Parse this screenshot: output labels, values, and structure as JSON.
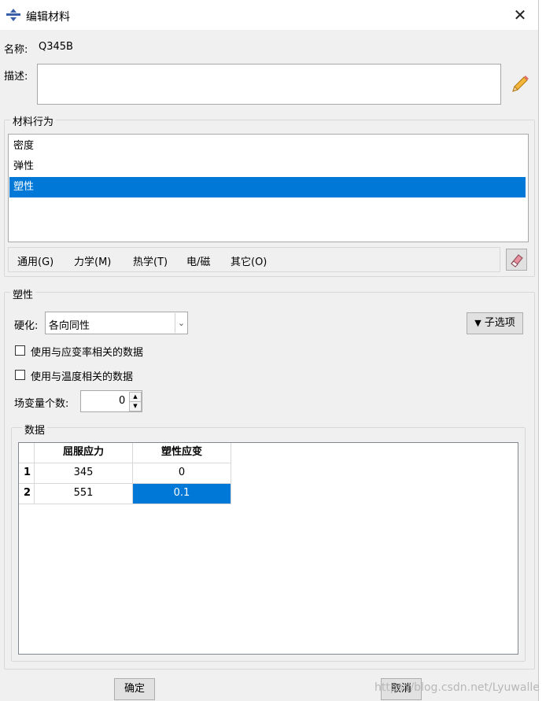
{
  "window": {
    "title": "编辑材料",
    "close": "✕"
  },
  "name_field": {
    "label": "名称:",
    "value": "Q345B"
  },
  "description": {
    "label": "描述:",
    "value": ""
  },
  "behavior_group": {
    "title": "材料行为",
    "items": [
      "密度",
      "弹性",
      "塑性"
    ],
    "selected_index": 2
  },
  "menu": [
    {
      "label": "通用(G)"
    },
    {
      "label": "力学(M)"
    },
    {
      "label": "热学(T)"
    },
    {
      "label": "电/磁"
    },
    {
      "label": "其它(O)"
    }
  ],
  "plastic": {
    "title": "塑性",
    "hardening_label": "硬化:",
    "hardening_value": "各向同性",
    "suboptions_label": "子选项",
    "use_strain_rate": "使用与应变率相关的数据",
    "use_temperature": "使用与温度相关的数据",
    "field_vars_label": "场变量个数:",
    "field_vars_value": "0"
  },
  "data_group": {
    "title": "数据",
    "columns": [
      "屈服应力",
      "塑性应变"
    ],
    "rows": [
      {
        "index": "1",
        "cells": [
          "345",
          "0"
        ]
      },
      {
        "index": "2",
        "cells": [
          "551",
          "0.1"
        ]
      }
    ],
    "selected_cell": [
      1,
      1
    ]
  },
  "buttons": {
    "ok": "确定",
    "cancel": "取消"
  },
  "watermark": "https://blog.csdn.net/Lyuwalle",
  "colors": {
    "selection": "#0078d7",
    "background": "#f0f0f0"
  }
}
